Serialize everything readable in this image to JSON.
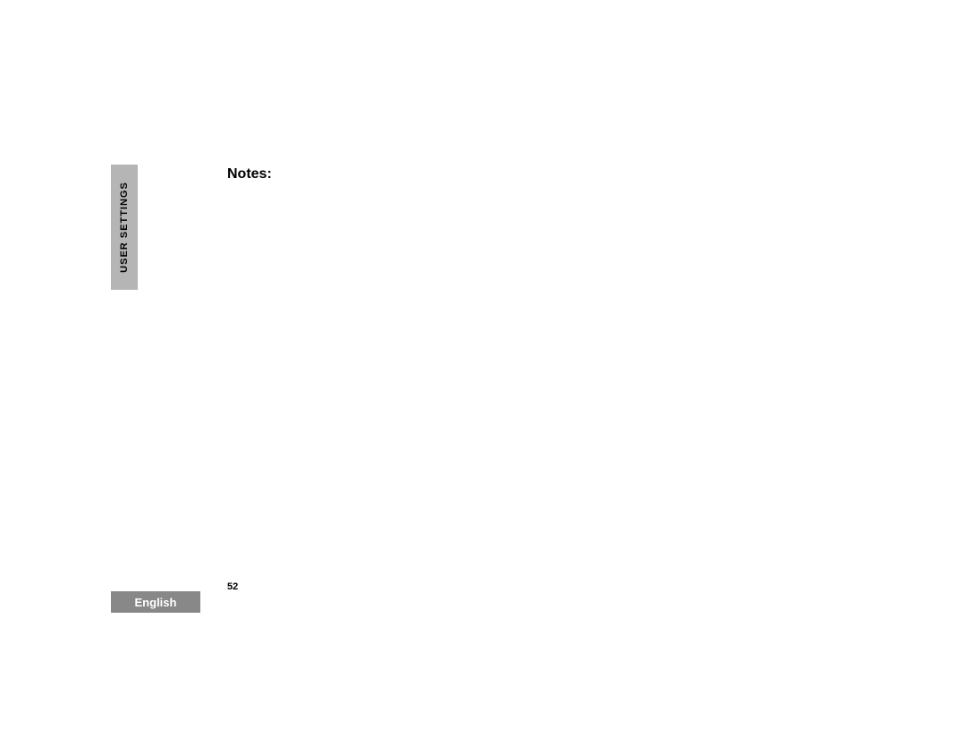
{
  "sidebar": {
    "section_label": "User Settings"
  },
  "content": {
    "heading": "Notes:"
  },
  "footer": {
    "page_number": "52",
    "language": "English"
  }
}
